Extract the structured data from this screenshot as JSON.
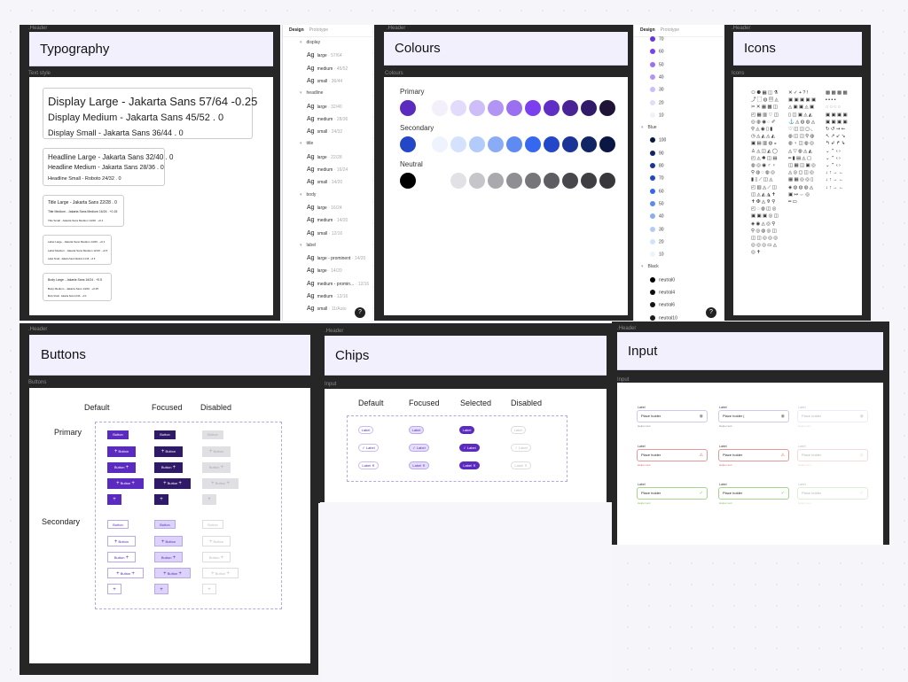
{
  "typography": {
    "header_label": ".Header",
    "title": "Typography",
    "section_label": "Text style",
    "groups": [
      [
        "Display Large - Jakarta Sans 57/64 -0.25",
        "Display Medium - Jakarta Sans 45/52 . 0",
        "Display Small - Jakarta Sans 36/44 . 0"
      ],
      [
        "Headline Large - Jakarta Sans 32/40 . 0",
        "Headline Medium - Jakarta Sans 28/36 . 0",
        "Headline Small - Roboto 24/32 . 0"
      ],
      [
        "Title Large - Jakarta Sans 22/28 . 0",
        "Title Medium - Jakarta Sans Medium 16/24 . +0.15",
        "Title Small - Jakarta Sans Medium 14/20 . +0.1"
      ],
      [
        "Label Large - Jakarta Sans Medium 14/20 . +0.1",
        "Label Medium - Jakarta Sans Medium 12/16 . +0.5",
        "Label Small - Jakarta Sans Medium 11/16 . +0.5"
      ],
      [
        "Body Large - Jakarta Sans 16/24 . +0.5",
        "Body Medium - Jakarta Sans 14/20 . +0.25",
        "Body Small - Jakarta Sans 12/16 . +0.4"
      ]
    ]
  },
  "panel1": {
    "tabs": [
      "Design",
      "Prototype"
    ],
    "help": "?",
    "rows": [
      {
        "g": "display"
      },
      {
        "a": "Ag",
        "n": "large",
        "m": "57/64"
      },
      {
        "a": "Ag",
        "n": "medium",
        "m": "45/52"
      },
      {
        "a": "Ag",
        "n": "small",
        "m": "36/44"
      },
      {
        "g": "headline"
      },
      {
        "a": "Ag",
        "n": "large",
        "m": "32/40"
      },
      {
        "a": "Ag",
        "n": "medium",
        "m": "28/36"
      },
      {
        "a": "Ag",
        "n": "small",
        "m": "24/32"
      },
      {
        "g": "title"
      },
      {
        "a": "Ag",
        "n": "large",
        "m": "22/28"
      },
      {
        "a": "Ag",
        "n": "medium",
        "m": "16/24"
      },
      {
        "a": "Ag",
        "n": "small",
        "m": "14/20"
      },
      {
        "g": "body"
      },
      {
        "a": "Ag",
        "n": "large",
        "m": "16/24"
      },
      {
        "a": "Ag",
        "n": "medium",
        "m": "14/20"
      },
      {
        "a": "Ag",
        "n": "small",
        "m": "12/16"
      },
      {
        "g": "label"
      },
      {
        "a": "Ag",
        "n": "large - prominent",
        "m": "14/20"
      },
      {
        "a": "Ag",
        "n": "large",
        "m": "14/20"
      },
      {
        "a": "Ag",
        "n": "medium - promin...",
        "m": "12/16"
      },
      {
        "a": "Ag",
        "n": "medium",
        "m": "12/16"
      },
      {
        "a": "Ag",
        "n": "small",
        "m": "11/Auto"
      }
    ]
  },
  "colours": {
    "header_label": ".Header",
    "title": "Colours",
    "section_label": "Colours",
    "palettes": [
      {
        "name": "Primary",
        "key": "#5b2bc0",
        "scale": [
          "#f3f0fc",
          "#e3dbfb",
          "#cdbdf8",
          "#b194f4",
          "#9a70f1",
          "#7c3ff0",
          "#5f2ec4",
          "#4a2396",
          "#321a6b",
          "#1f1438"
        ]
      },
      {
        "name": "Secondary",
        "key": "#2447c8",
        "scale": [
          "#eef3fe",
          "#d5e2fd",
          "#b3cbfb",
          "#8aacf7",
          "#5e8af2",
          "#3568ef",
          "#2447c8",
          "#1a3497",
          "#112466",
          "#0a1743"
        ]
      },
      {
        "name": "Neutral",
        "key": "#000000",
        "scale": [
          "#ffffff",
          "#e2e1e6",
          "#c6c5ca",
          "#aaa9ae",
          "#8f8e93",
          "#76757a",
          "#5e5d62",
          "#48474c",
          "#3f3e43",
          "#38373c"
        ]
      }
    ]
  },
  "panel2": {
    "tabs": [
      "Design",
      "Prototype"
    ],
    "help": "?",
    "rows": [
      {
        "c": "#6a34d8",
        "n": "70"
      },
      {
        "c": "#7c3ff0",
        "n": "60"
      },
      {
        "c": "#9a70f1",
        "n": "50"
      },
      {
        "c": "#b194f4",
        "n": "40"
      },
      {
        "c": "#cdbdf8",
        "n": "30"
      },
      {
        "c": "#e3dbfb",
        "n": "20"
      },
      {
        "c": "#f3f0fc",
        "n": "10"
      },
      {
        "g": "Blue"
      },
      {
        "c": "#0a1743",
        "n": "100"
      },
      {
        "c": "#112466",
        "n": "90"
      },
      {
        "c": "#1a3497",
        "n": "80"
      },
      {
        "c": "#2447c8",
        "n": "70"
      },
      {
        "c": "#3568ef",
        "n": "60"
      },
      {
        "c": "#5e8af2",
        "n": "50"
      },
      {
        "c": "#8aacf7",
        "n": "40"
      },
      {
        "c": "#b3cbfb",
        "n": "30"
      },
      {
        "c": "#d5e2fd",
        "n": "20"
      },
      {
        "c": "#eef3fe",
        "n": "10"
      },
      {
        "g": "Black"
      },
      {
        "c": "#000000",
        "n": "neutral0"
      },
      {
        "c": "#0d0d0d",
        "n": "neutral4"
      },
      {
        "c": "#141414",
        "n": "neutral6"
      },
      {
        "c": "#1c1c1c",
        "n": "neutral10"
      }
    ]
  },
  "icons": {
    "header_label": ".Header",
    "title": "Icons",
    "section_label": "Icons",
    "columns": [
      "⚇⚈▦◫⚗\n⤴▢◍▤◬\n✂✕▦▩◫\n◰▦▥♡◫\n◎◍◉◌✐\n⚲◬◉▯▮\n◷◬◭◬◭\n▣▤▥◍◒\n♙◬◫◭◯\n◰◬✱◫▤\n◍◎◉♂♀\n⚲◍◌◍◎\n▮▯⟋◫◬\n◰▥◬⟋◫\n◫◬◭◮✝\n✝✠◬✞⚲\n◰◌◍◫◎\n▣▣▣◎◫\n◈◉◬◎⚲\n⚲◎◍◎◫\n◫◫◎◎◎\n◎◎◎▭◬\n◎✝",
      "✕✓+?!\n▣▣▣▣▣\n◬▣▣◬▣\n▯◫▣◬◭\n⚓◬◍◍◬\n♡◫◫◻◟\n◍◫◫⚲◍\n◍♀◫◍◎\n◬▽◍◬◭\n━▮▤◬▢\n◫▦◫▣◎\n◬◎◻◫◎\n▦▦◎◎▯\n◈◍◍◍◬\n▣↦⇔◎\n━▭",
      "▩▩▩▩\n▪▪▪▪\n◌◌◌◌\n▣▣▣▣\n▣▣▣▣\n↻↺⇝⇜\n↖↗↙↘\n↰↲↱↳\n⌄⌃‹›\n⌄⌃‹›\n⌄⌃‹›\n↓↑→←\n↓↑→←\n↓↑→←"
    ]
  },
  "buttons": {
    "header_label": ".Header",
    "title": "Buttons",
    "section_label": "Buttons",
    "columns": [
      "Default",
      "Focused",
      "Disabled"
    ],
    "rows": [
      "Primary",
      "Secondary"
    ],
    "label": "Button",
    "plus": "+",
    "colors": {
      "primary_default": "#5b2bc0",
      "primary_focused": "#2e1a66",
      "primary_disabled": "#e0dfe3",
      "secondary_border": "#b9a8ea",
      "secondary_focused": "#ddd2fa"
    }
  },
  "chips": {
    "header_label": ".Header",
    "title": "Chips",
    "section_label": "Input",
    "columns": [
      "Default",
      "Focused",
      "Selected",
      "Disabled"
    ],
    "label": "Label",
    "check": "✓",
    "close": "✕"
  },
  "input": {
    "header_label": ".Header",
    "title": "Input",
    "section_label": "Input",
    "label": "Label",
    "placeholder": "Place holder",
    "focused_value": "Place holder |",
    "helper": "Helper text",
    "colors": {
      "default": "#cfc8ef",
      "error": "#e59a9a",
      "success": "#a6d48d"
    },
    "icons": [
      "eye-icon",
      "warning-icon",
      "check-icon"
    ]
  }
}
